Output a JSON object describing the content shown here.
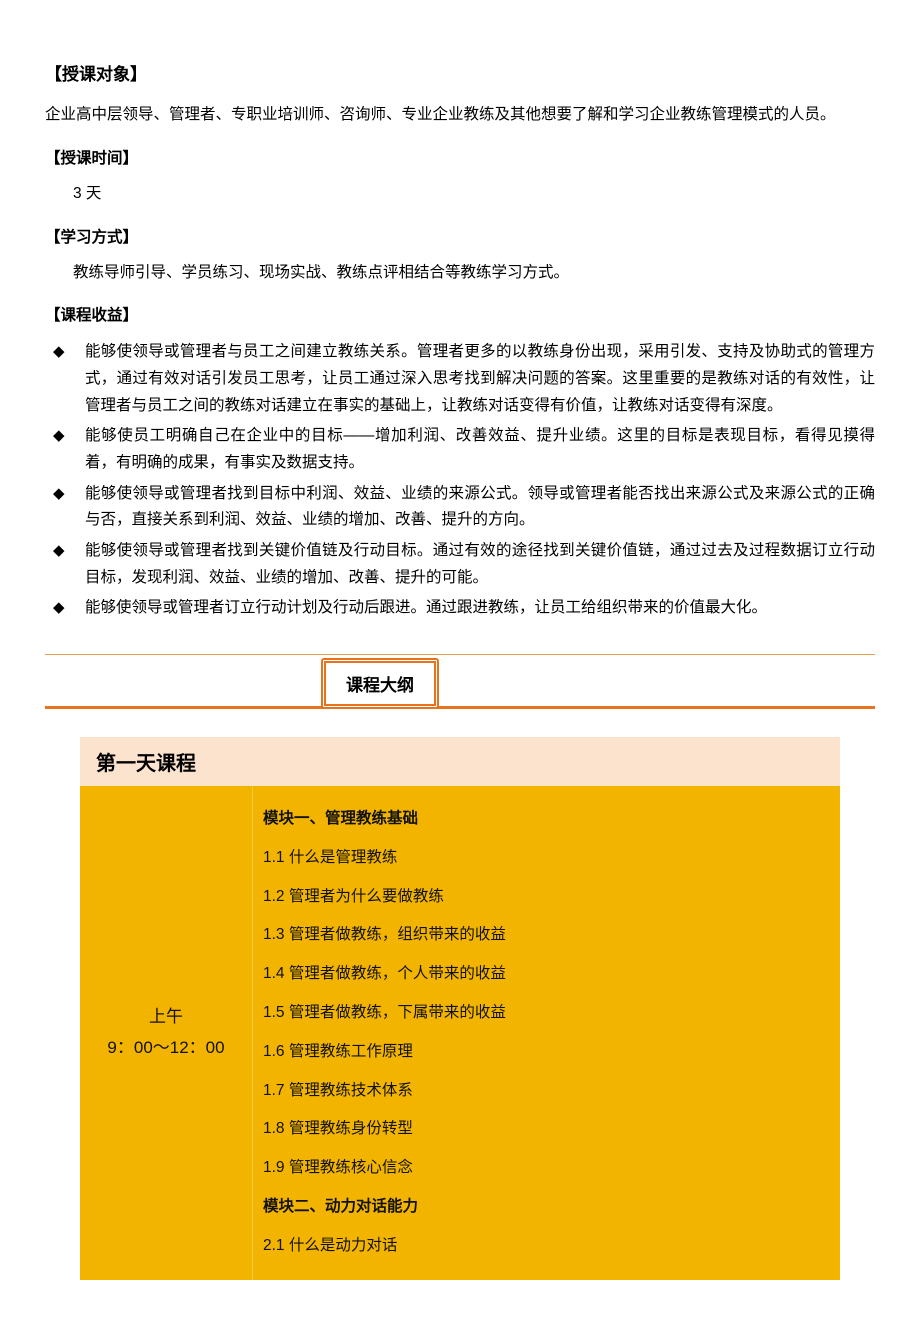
{
  "headings": {
    "audience": "【授课对象】",
    "time": "【授课时间】",
    "method": "【学习方式】",
    "benefits": "【课程收益】"
  },
  "audience_text": "企业高中层领导、管理者、专职业培训师、咨询师、专业企业教练及其他想要了解和学习企业教练管理模式的人员。",
  "time_text": "3 天",
  "method_text": "教练导师引导、学员练习、现场实战、教练点评相结合等教练学习方式。",
  "benefits": [
    "能够使领导或管理者与员工之间建立教练关系。管理者更多的以教练身份出现，采用引发、支持及协助式的管理方式，通过有效对话引发员工思考，让员工通过深入思考找到解决问题的答案。这里重要的是教练对话的有效性，让管理者与员工之间的教练对话建立在事实的基础上，让教练对话变得有价值，让教练对话变得有深度。",
    "能够使员工明确自己在企业中的目标——增加利润、改善效益、提升业绩。这里的目标是表现目标，看得见摸得着，有明确的成果，有事实及数据支持。",
    "能够使领导或管理者找到目标中利润、效益、业绩的来源公式。领导或管理者能否找出来源公式及来源公式的正确与否，直接关系到利润、效益、业绩的增加、改善、提升的方向。",
    "能够使领导或管理者找到关键价值链及行动目标。通过有效的途径找到关键价值链，通过过去及过程数据订立行动目标，发现利润、效益、业绩的增加、改善、提升的可能。",
    "能够使领导或管理者订立行动计划及行动后跟进。通过跟进教练，让员工给组织带来的价值最大化。"
  ],
  "outline_badge": "课程大纲",
  "day": {
    "title": "第一天课程",
    "time_label_1": "上午",
    "time_label_2": "9：00～12：00",
    "content": [
      {
        "text": "模块一、管理教练基础",
        "bold": true
      },
      {
        "text": "1.1 什么是管理教练",
        "bold": false
      },
      {
        "text": "1.2 管理者为什么要做教练",
        "bold": false
      },
      {
        "text": "1.3 管理者做教练，组织带来的收益",
        "bold": false
      },
      {
        "text": "1.4 管理者做教练，个人带来的收益",
        "bold": false
      },
      {
        "text": "1.5 管理者做教练，下属带来的收益",
        "bold": false
      },
      {
        "text": "1.6 管理教练工作原理",
        "bold": false
      },
      {
        "text": "1.7 管理教练技术体系",
        "bold": false
      },
      {
        "text": "1.8 管理教练身份转型",
        "bold": false
      },
      {
        "text": "1.9 管理教练核心信念",
        "bold": false
      },
      {
        "text": "模块二、动力对话能力",
        "bold": true
      },
      {
        "text": "2.1 什么是动力对话",
        "bold": false
      }
    ]
  }
}
